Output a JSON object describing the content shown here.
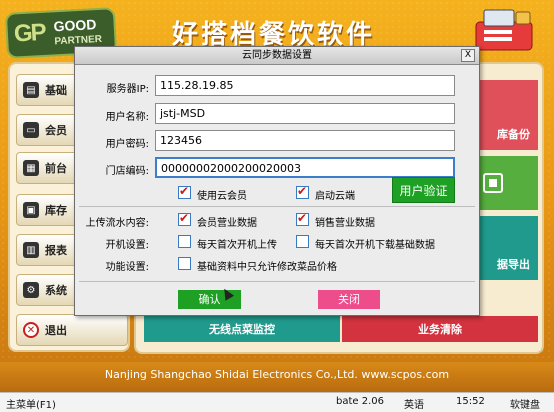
{
  "app": {
    "title": "好搭档餐饮软件",
    "logo": {
      "initials": "GP",
      "line1": "GOOD",
      "line2": "PARTNER"
    },
    "footer_text": "Nanjing Shangchao Shidai Electronics Co.,Ltd. www.scpos.com"
  },
  "sidebar": {
    "items": [
      {
        "label": "基础",
        "icon": "grid-icon"
      },
      {
        "label": "会员",
        "icon": "member-card-icon"
      },
      {
        "label": "前台",
        "icon": "cashier-icon"
      },
      {
        "label": "库存",
        "icon": "inventory-icon"
      },
      {
        "label": "报表",
        "icon": "report-icon"
      },
      {
        "label": "系统",
        "icon": "gear-icon"
      },
      {
        "label": "退出",
        "icon": "exit-icon"
      }
    ]
  },
  "tiles": {
    "backup": "库备份",
    "data_export": "据导出",
    "wireless_order": "无线点菜监控",
    "business_clear": "业务清除"
  },
  "dialog": {
    "title": "云同步数据设置",
    "close_glyph": "X",
    "fields": {
      "server_ip": {
        "label": "服务器IP:",
        "value": "115.28.19.85"
      },
      "username": {
        "label": "用户名称:",
        "value": "jstj-MSD"
      },
      "password": {
        "label": "用户密码:",
        "value": "123456"
      },
      "store_code": {
        "label": "门店编码:",
        "value": "00000002000200020003"
      }
    },
    "options": {
      "use_cloud_member": {
        "label": "使用云会员",
        "checked": true
      },
      "enable_cloud_end": {
        "label": "启动云端",
        "checked": true
      }
    },
    "user_verify_button": "用户验证",
    "upload_label": "上传流水内容:",
    "upload_options": {
      "member_business": {
        "label": "会员营业数据",
        "checked": true
      },
      "sales_business": {
        "label": "销售营业数据",
        "checked": true
      }
    },
    "startup_label": "开机设置:",
    "startup_options": {
      "daily_upload": {
        "label": "每天首次开机上传",
        "checked": false
      },
      "daily_download": {
        "label": "每天首次开机下载基础数据",
        "checked": false
      }
    },
    "function_label": "功能设置:",
    "function_options": {
      "price_edit": {
        "label": "基础资料中只允许修改菜品价格",
        "checked": false
      }
    },
    "ok_button": "确认",
    "close_button": "关闭"
  },
  "taskbar": {
    "start": "主菜单(F1)",
    "version": "bate 2.06",
    "lang": "英语",
    "time": "15:52",
    "keyboard": "软键盘"
  },
  "colors": {
    "background": "#f0a81c",
    "accent_green": "#1ea024",
    "accent_pink": "#ee4d8c",
    "tile_red": "#e0505a",
    "tile_green": "#56ae3e",
    "tile_teal": "#1f9a8c",
    "tile_darkred": "#d2333e"
  }
}
